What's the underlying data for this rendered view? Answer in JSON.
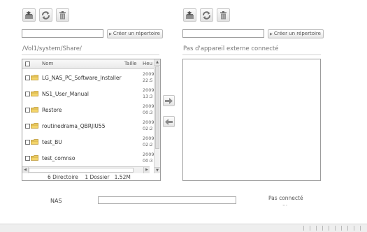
{
  "left": {
    "toolbar": [
      "upload-icon",
      "refresh-icon",
      "trash-icon"
    ],
    "new_dir_button": "Créer un répertoire",
    "path": "/Vol1/system/Share/",
    "table": {
      "headers": {
        "name": "Nom",
        "size": "Taille",
        "time": "Heu"
      },
      "rows": [
        {
          "name": "LG_NAS_PC_Software_Installer",
          "time": "2009\n22:5"
        },
        {
          "name": "NS1_User_Manual",
          "time": "2009\n13:3"
        },
        {
          "name": "Restore",
          "time": "2009\n00:3"
        },
        {
          "name": "routinedrama_QBRJIU55",
          "time": "2009\n02:2"
        },
        {
          "name": "test_BU",
          "time": "2009\n02:2"
        },
        {
          "name": "test_comnso",
          "time": "2009\n00:3"
        }
      ]
    },
    "summary": {
      "dirs": "6 Directoire",
      "files": "1 Dossier",
      "size": "1.52M"
    }
  },
  "right": {
    "toolbar": [
      "upload-icon",
      "refresh-icon",
      "trash-icon"
    ],
    "new_dir_button": "Créer un répertoire",
    "path": "Pas d'appareil externe connecté"
  },
  "footer": {
    "nas_label": "NAS",
    "status_line1": "Pas connecté",
    "status_line2": "..."
  }
}
